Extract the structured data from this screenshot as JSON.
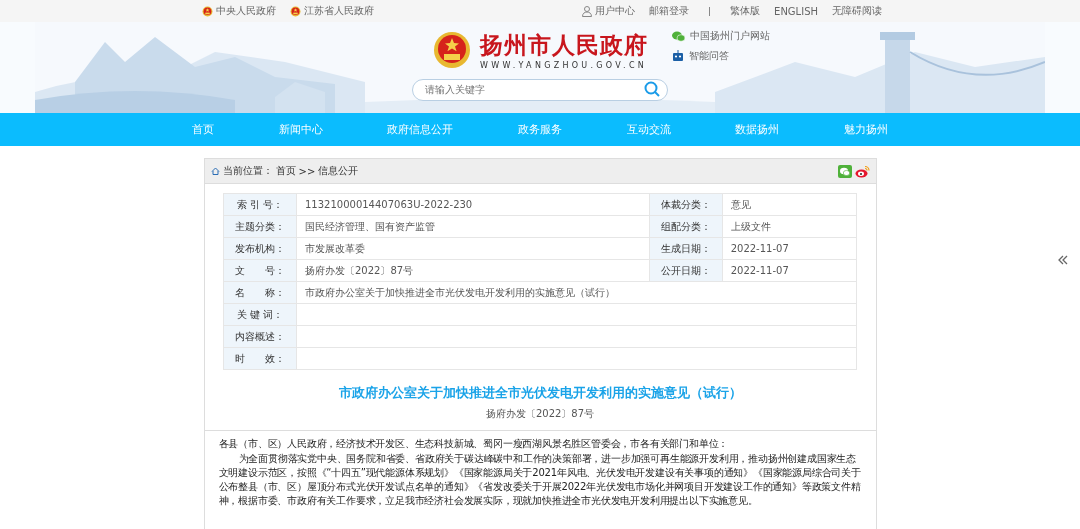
{
  "top_bar": {
    "left_links": [
      "中央人民政府",
      "江苏省人民政府"
    ],
    "right_links": [
      "用户中心",
      "邮箱登录",
      "繁体版",
      "ENGLISH",
      "无障碍阅读"
    ]
  },
  "header": {
    "site_name": "扬州市人民政府",
    "site_url": "WWW.YANGZHOU.GOV.CN",
    "side_links": [
      "中国扬州门户网站",
      "智能问答"
    ],
    "search": {
      "placeholder": "请输入关键字"
    }
  },
  "nav": {
    "items": [
      {
        "label": "首页",
        "selected": false
      },
      {
        "label": "新闻中心",
        "selected": false
      },
      {
        "label": "政府信息公开",
        "selected": false
      },
      {
        "label": "政务服务",
        "selected": false
      },
      {
        "label": "互动交流",
        "selected": false
      },
      {
        "label": "数据扬州",
        "selected": false
      },
      {
        "label": "魅力扬州",
        "selected": false
      }
    ]
  },
  "breadcrumb": {
    "label": "当前位置：",
    "items": [
      "首页",
      ">>",
      "信息公开"
    ]
  },
  "meta_table": {
    "rows": [
      {
        "cells": [
          {
            "label": "索 引 号：",
            "value": "11321000014407063U-2022-230"
          },
          {
            "label": "体裁分类：",
            "value": "意见"
          }
        ]
      },
      {
        "cells": [
          {
            "label": "主题分类：",
            "value": "国民经济管理、国有资产监管"
          },
          {
            "label": "组配分类：",
            "value": "上级文件"
          }
        ]
      },
      {
        "cells": [
          {
            "label": "发布机构：",
            "value": "市发展改革委"
          },
          {
            "label": "生成日期：",
            "value": "2022-11-07"
          }
        ]
      },
      {
        "cells": [
          {
            "label": "文　　号：",
            "value": "扬府办发〔2022〕87号"
          },
          {
            "label": "公开日期：",
            "value": "2022-11-07"
          }
        ]
      },
      {
        "cells": [
          {
            "label": "名　　称：",
            "value": "市政府办公室关于加快推进全市光伏发电开发利用的实施意见（试行）"
          }
        ]
      },
      {
        "cells": [
          {
            "label": "关 键 词："
          }
        ]
      },
      {
        "cells": [
          {
            "label": "内容概述："
          }
        ]
      },
      {
        "cells": [
          {
            "label": "时　　效："
          }
        ]
      }
    ]
  },
  "article": {
    "title": "市政府办公室关于加快推进全市光伏发电开发利用的实施意见（试行）",
    "doc_number": "扬府办发〔2022〕87号",
    "paragraphs": [
      {
        "text": "各县（市、区）人民政府，经济技术开发区、生态科技新城、蜀冈一瘦西湖风景名胜区管委会，市各有关部门和单位：",
        "indent": false
      },
      {
        "text": "为全面贯彻落实党中央、国务院和省委、省政府关于碳达峰碳中和工作的决策部署，进一步加强可再生能源开发利用，推动扬州创建成国家生态文明建设示范区，按照《“十四五”现代能源体系规划》《国家能源局关于2021年风电、光伏发电开发建设有关事项的通知》《国家能源局综合司关于公布整县（市、区）屋顶分布式光伏开发试点名单的通知》《省发改委关于开展2022年光伏发电市场化并网项目开发建设工作的通知》等政策文件精神，根据市委、市政府有关工作要求，立足我市经济社会发展实际，现就加快推进全市光伏发电开发利用提出以下实施意见。",
        "indent": true
      }
    ]
  }
}
